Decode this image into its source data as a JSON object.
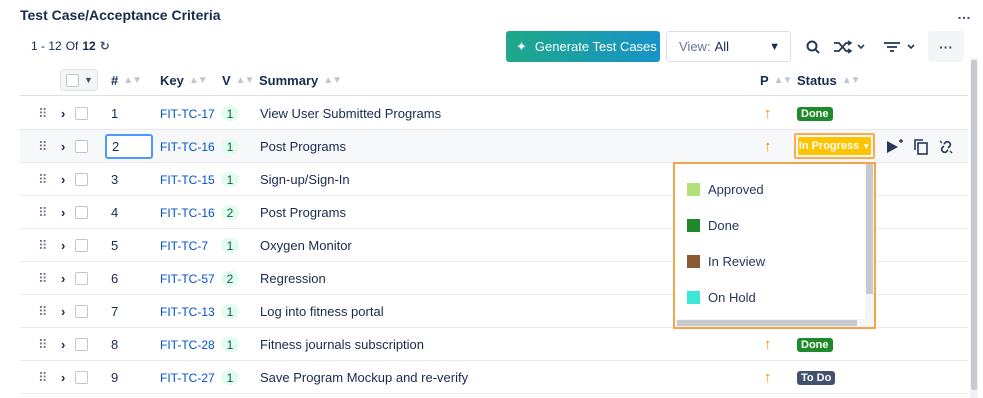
{
  "title": "Test Case/Acceptance Criteria",
  "more_icon": "…",
  "toolbar": {
    "range": "1 - 12",
    "of_label": "Of",
    "total": "12",
    "generate_label": "Generate Test Cases",
    "view_label": "View:",
    "view_value": "All"
  },
  "columns": {
    "number": "#",
    "key": "Key",
    "version": "V",
    "summary": "Summary",
    "priority": "P",
    "status": "Status"
  },
  "rows": [
    {
      "num": "1",
      "key": "FIT-TC-17",
      "ver": "1",
      "summary": "View User Submitted Programs",
      "status": "Done"
    },
    {
      "num": "2",
      "key": "FIT-TC-16",
      "ver": "1",
      "summary": "Post Programs",
      "status": "In Progress"
    },
    {
      "num": "3",
      "key": "FIT-TC-15",
      "ver": "1",
      "summary": "Sign-up/Sign-In",
      "status": ""
    },
    {
      "num": "4",
      "key": "FIT-TC-16",
      "ver": "2",
      "summary": "Post Programs",
      "status": ""
    },
    {
      "num": "5",
      "key": "FIT-TC-7",
      "ver": "1",
      "summary": "Oxygen Monitor",
      "status": ""
    },
    {
      "num": "6",
      "key": "FIT-TC-57",
      "ver": "2",
      "summary": "Regression",
      "status": ""
    },
    {
      "num": "7",
      "key": "FIT-TC-13",
      "ver": "1",
      "summary": "Log into fitness portal",
      "status": ""
    },
    {
      "num": "8",
      "key": "FIT-TC-28",
      "ver": "1",
      "summary": "Fitness journals subscription",
      "status": "Done"
    },
    {
      "num": "9",
      "key": "FIT-TC-27",
      "ver": "1",
      "summary": "Save Program Mockup and re-verify",
      "status": "To Do"
    }
  ],
  "status_options": [
    {
      "label": "Approved",
      "color": "#b3e07b"
    },
    {
      "label": "Done",
      "color": "#1f8a2c"
    },
    {
      "label": "In Review",
      "color": "#8a5a32"
    },
    {
      "label": "On Hold",
      "color": "#3ae8d8"
    }
  ],
  "colors": {
    "done": "#1f8a2c",
    "todo": "#42526e",
    "in_progress": "#ffc400",
    "priority": "#ff8b00",
    "link": "#0052cc"
  }
}
